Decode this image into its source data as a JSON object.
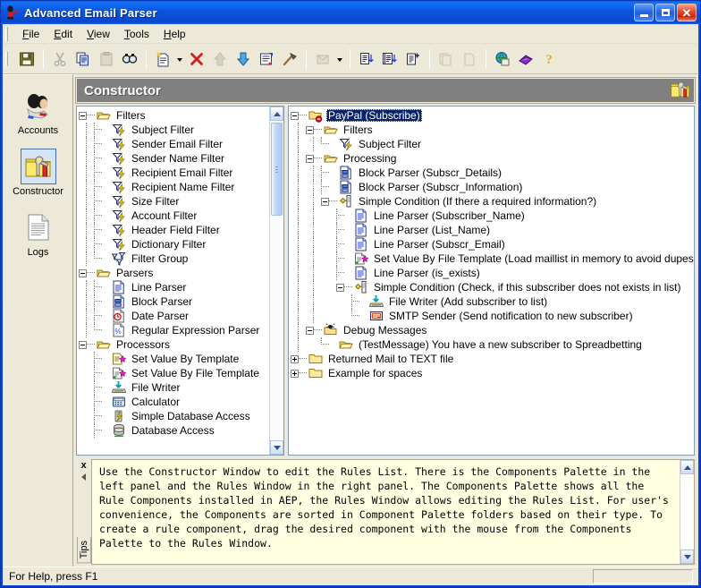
{
  "window": {
    "title": "Advanced Email Parser",
    "icon": "parser-app-icon",
    "controls": {
      "minimize": "_",
      "maximize": "□",
      "close": "✕"
    }
  },
  "menu": [
    {
      "label": "File",
      "accel": "F"
    },
    {
      "label": "Edit",
      "accel": "E"
    },
    {
      "label": "View",
      "accel": "V"
    },
    {
      "label": "Tools",
      "accel": "T"
    },
    {
      "label": "Help",
      "accel": "H"
    }
  ],
  "toolbar": [
    {
      "name": "save-icon",
      "type": "button",
      "enabled": true
    },
    {
      "name": "separator",
      "type": "sep"
    },
    {
      "name": "cut-icon",
      "type": "button",
      "enabled": false
    },
    {
      "name": "copy-icon",
      "type": "button",
      "enabled": true
    },
    {
      "name": "paste-icon",
      "type": "button",
      "enabled": false
    },
    {
      "name": "find-icon",
      "type": "button",
      "enabled": true
    },
    {
      "name": "separator",
      "type": "sep"
    },
    {
      "name": "new-item-icon",
      "type": "button",
      "enabled": true
    },
    {
      "name": "new-item-dropdown",
      "type": "arrow"
    },
    {
      "name": "delete-icon",
      "type": "button",
      "enabled": true
    },
    {
      "name": "move-up-icon",
      "type": "button",
      "enabled": false
    },
    {
      "name": "move-down-icon",
      "type": "button",
      "enabled": true
    },
    {
      "name": "properties-icon",
      "type": "button",
      "enabled": true
    },
    {
      "name": "build-icon",
      "type": "button",
      "enabled": true
    },
    {
      "name": "separator",
      "type": "sep"
    },
    {
      "name": "send-receive-icon",
      "type": "button",
      "enabled": false
    },
    {
      "name": "send-receive-dropdown",
      "type": "arrow"
    },
    {
      "name": "separator",
      "type": "sep"
    },
    {
      "name": "import-list-icon",
      "type": "button",
      "enabled": true
    },
    {
      "name": "export-list-icon",
      "type": "button",
      "enabled": true
    },
    {
      "name": "add-list-icon",
      "type": "button",
      "enabled": true
    },
    {
      "name": "separator",
      "type": "sep"
    },
    {
      "name": "copy-rules-icon",
      "type": "button",
      "enabled": false
    },
    {
      "name": "copy-rule-icon",
      "type": "button",
      "enabled": false
    },
    {
      "name": "separator",
      "type": "sep"
    },
    {
      "name": "web-icon",
      "type": "button",
      "enabled": true
    },
    {
      "name": "manual-icon",
      "type": "button",
      "enabled": true
    },
    {
      "name": "help-icon",
      "type": "button",
      "enabled": true
    }
  ],
  "sidebar": {
    "items": [
      {
        "label": "Accounts",
        "icon": "accounts-icon",
        "selected": false
      },
      {
        "label": "Constructor",
        "icon": "constructor-icon",
        "selected": true
      },
      {
        "label": "Logs",
        "icon": "logs-icon",
        "selected": false
      }
    ]
  },
  "caption": {
    "title": "Constructor",
    "icon": "constructor-icon"
  },
  "palette_tree": {
    "nodes": [
      {
        "depth": 0,
        "label": "Filters",
        "icon": "folder-open-icon",
        "expander": "minus"
      },
      {
        "depth": 1,
        "label": "Subject Filter",
        "icon": "filter-icon"
      },
      {
        "depth": 1,
        "label": "Sender Email Filter",
        "icon": "filter-icon"
      },
      {
        "depth": 1,
        "label": "Sender Name Filter",
        "icon": "filter-icon"
      },
      {
        "depth": 1,
        "label": "Recipient Email Filter",
        "icon": "filter-icon"
      },
      {
        "depth": 1,
        "label": "Recipient Name Filter",
        "icon": "filter-icon"
      },
      {
        "depth": 1,
        "label": "Size Filter",
        "icon": "filter-icon"
      },
      {
        "depth": 1,
        "label": "Account Filter",
        "icon": "filter-icon"
      },
      {
        "depth": 1,
        "label": "Header Field Filter",
        "icon": "filter-icon"
      },
      {
        "depth": 1,
        "label": "Dictionary Filter",
        "icon": "filter-icon"
      },
      {
        "depth": 1,
        "label": "Filter Group",
        "icon": "filter-group-icon",
        "last": true
      },
      {
        "depth": 0,
        "label": "Parsers",
        "icon": "folder-open-icon",
        "expander": "minus"
      },
      {
        "depth": 1,
        "label": "Line Parser",
        "icon": "line-parser-icon"
      },
      {
        "depth": 1,
        "label": "Block Parser",
        "icon": "block-parser-icon"
      },
      {
        "depth": 1,
        "label": "Date Parser",
        "icon": "date-parser-icon"
      },
      {
        "depth": 1,
        "label": "Regular Expression Parser",
        "icon": "regex-parser-icon",
        "last": true
      },
      {
        "depth": 0,
        "label": "Processors",
        "icon": "folder-open-icon",
        "expander": "minus"
      },
      {
        "depth": 1,
        "label": "Set Value By Template",
        "icon": "set-value-template-icon"
      },
      {
        "depth": 1,
        "label": "Set Value By File Template",
        "icon": "set-value-file-template-icon"
      },
      {
        "depth": 1,
        "label": "File Writer",
        "icon": "file-writer-icon"
      },
      {
        "depth": 1,
        "label": "Calculator",
        "icon": "calculator-icon"
      },
      {
        "depth": 1,
        "label": "Simple Database Access",
        "icon": "simple-db-access-icon"
      },
      {
        "depth": 1,
        "label": "Database Access",
        "icon": "database-access-icon"
      }
    ]
  },
  "rules_tree": {
    "nodes": [
      {
        "depth": 0,
        "label": "PayPal (Subscribe)",
        "icon": "rule-folder-stop-icon",
        "expander": "minus",
        "selected": true
      },
      {
        "depth": 1,
        "label": "Filters",
        "icon": "folder-open-icon",
        "expander": "minus"
      },
      {
        "depth": 2,
        "label": "Subject Filter",
        "icon": "filter-icon",
        "last": true
      },
      {
        "depth": 1,
        "label": "Processing",
        "icon": "folder-open-icon",
        "expander": "minus"
      },
      {
        "depth": 2,
        "label": "Block Parser (Subscr_Details)",
        "icon": "block-parser-icon"
      },
      {
        "depth": 2,
        "label": "Block Parser (Subscr_Information)",
        "icon": "block-parser-icon"
      },
      {
        "depth": 2,
        "label": "Simple Condition (If there a required information?)",
        "icon": "condition-icon",
        "expander": "minus"
      },
      {
        "depth": 3,
        "label": "Line Parser (Subscriber_Name)",
        "icon": "line-parser-icon"
      },
      {
        "depth": 3,
        "label": "Line Parser (List_Name)",
        "icon": "line-parser-icon"
      },
      {
        "depth": 3,
        "label": "Line Parser (Subscr_Email)",
        "icon": "line-parser-icon"
      },
      {
        "depth": 3,
        "label": "Set Value By File Template (Load maillist in memory to avoid dupes)",
        "icon": "set-value-file-template-icon"
      },
      {
        "depth": 3,
        "label": "Line Parser (is_exists)",
        "icon": "line-parser-icon"
      },
      {
        "depth": 3,
        "label": "Simple Condition (Check, if this subscriber does not exists in list)",
        "icon": "condition-icon",
        "expander": "minus",
        "last": true
      },
      {
        "depth": 4,
        "label": "File Writer (Add subscriber to list)",
        "icon": "file-writer-icon"
      },
      {
        "depth": 4,
        "label": "SMTP Sender (Send notification to new subscriber)",
        "icon": "smtp-sender-icon",
        "last": true
      },
      {
        "depth": 1,
        "label": "Debug Messages",
        "icon": "debug-folder-icon",
        "expander": "minus",
        "last": true
      },
      {
        "depth": 2,
        "label": "(TestMessage) You have a new subscriber to Spreadbetting",
        "icon": "folder-open-icon",
        "last": true
      },
      {
        "depth": 0,
        "label": "Returned Mail to TEXT file",
        "icon": "folder-closed-icon",
        "expander": "plus"
      },
      {
        "depth": 0,
        "label": "Example for spaces",
        "icon": "folder-closed-icon",
        "expander": "plus",
        "last": true
      }
    ]
  },
  "tips": {
    "tab_label": "Tips",
    "close_label": "x",
    "text": "Use the Constructor Window to edit the Rules List. There is the Components Palette in the left panel and the Rules Window in the right panel. The Components Palette shows all the Rule Components installed in AEP, the Rules Window allows editing the Rules List. For user's convenience, the Components are sorted in Component Palette folders based on their type. To create a rule component, drag the desired component with the mouse from the Components Palette to the Rules Window."
  },
  "status": {
    "text": "For Help, press F1"
  },
  "colors": {
    "title_blue": "#0a46d8",
    "face": "#ece9d8",
    "caption_gray": "#808080",
    "tips_bg": "#ffffe1",
    "selection": "#0a246a"
  }
}
